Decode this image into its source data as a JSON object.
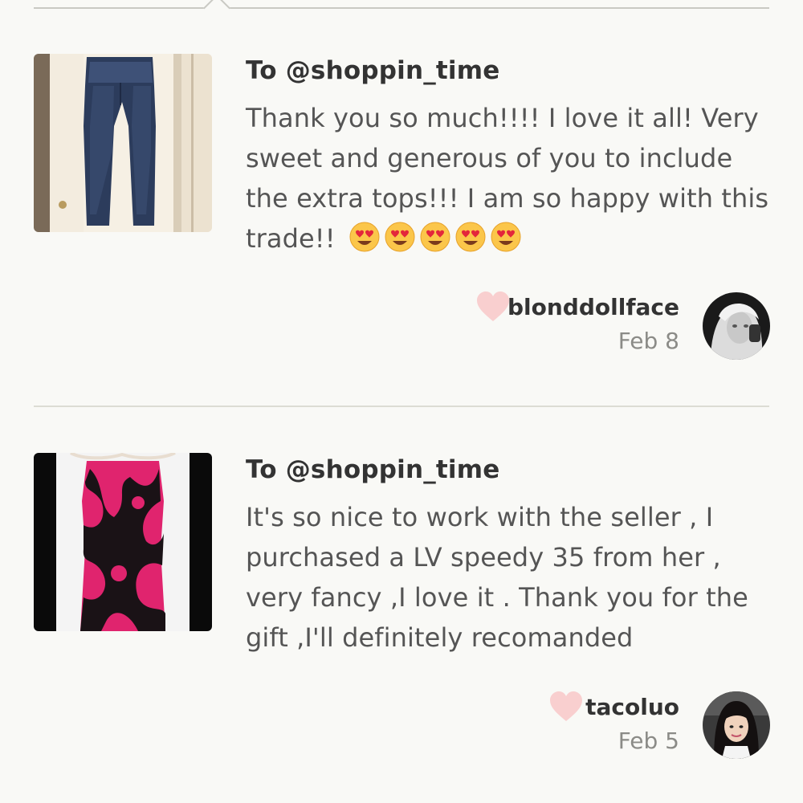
{
  "reviews": [
    {
      "to": "To @shoppin_time",
      "text": "Thank you so much!!!! I love it all! Very sweet and generous of you to include the extra tops!!! I am so happy with this trade!!",
      "emoji_count": 5,
      "emoji_icon": "heart-eyes-emoji-icon",
      "username": "blonddollface",
      "date": "Feb 8",
      "thumbnail": "jeans-photo",
      "avatar": "user-avatar-photo"
    },
    {
      "to": "To @shoppin_time",
      "text": "It's so nice to work with the seller , I purchased a LV speedy 35 from her , very fancy ,I love it . Thank you for the gift ,I'll definitely recomanded",
      "username": "tacoluo",
      "date": "Feb 5",
      "thumbnail": "pink-floral-dress-photo",
      "avatar": "user-avatar-photo"
    }
  ],
  "colors": {
    "background": "#f9f9f6",
    "heart": "#f9cfcf",
    "divider": "#dcdcd4",
    "dress_pink": "#e0246e"
  }
}
